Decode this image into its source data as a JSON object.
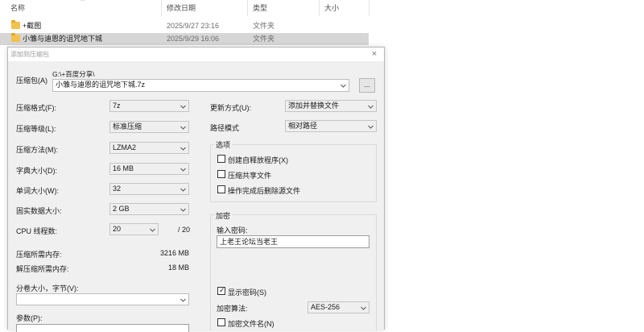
{
  "explorer": {
    "headers": {
      "name": "名称",
      "date": "修改日期",
      "type": "类型",
      "size": "大小"
    },
    "rows": [
      {
        "name": "+截图",
        "date": "2025/9/27 23:16",
        "type": "文件夹",
        "selected": false
      },
      {
        "name": "小雏与迪恩的诅咒地下城",
        "date": "2025/9/29 16:06",
        "type": "文件夹",
        "selected": true
      }
    ]
  },
  "dialog": {
    "title": "添加到压缩包",
    "archive": {
      "label": "压缩包(A)",
      "path": "G:\\+百度分享\\",
      "value": "小雏与迪恩的诅咒地下城.7z",
      "browse_label": "..."
    },
    "format": {
      "label": "压缩格式(F):",
      "value": "7z"
    },
    "level": {
      "label": "压缩等级(L):",
      "value": "标准压缩"
    },
    "method": {
      "label": "压缩方法(M):",
      "value": "LZMA2"
    },
    "dict": {
      "label": "字典大小(D):",
      "value": "16 MB"
    },
    "word": {
      "label": "单词大小(W):",
      "value": "32"
    },
    "solid": {
      "label": "固实数据大小:",
      "value": "2 GB"
    },
    "threads": {
      "label": "CPU 线程数:",
      "value": "20",
      "total": "/ 20"
    },
    "mem_compress": {
      "label": "压缩所需内存:",
      "value": "3216 MB"
    },
    "mem_decompress": {
      "label": "解压缩所需内存:",
      "value": "18 MB"
    },
    "split": {
      "label": "分卷大小，字节(V):",
      "value": ""
    },
    "params": {
      "label": "参数(P):",
      "value": ""
    },
    "update": {
      "label": "更新方式(U):",
      "value": "添加并替换文件"
    },
    "pathmode": {
      "label": "路径模式",
      "value": "相对路径"
    },
    "options": {
      "title": "选项",
      "items": [
        {
          "label": "创建自释放程序(X)",
          "checked": false
        },
        {
          "label": "压缩共享文件",
          "checked": false
        },
        {
          "label": "操作完成后删除源文件",
          "checked": false
        }
      ]
    },
    "encryption": {
      "title": "加密",
      "password_label": "输入密码:",
      "password_value": "上老王论坛当老王",
      "show_password": {
        "label": "显示密码(S)",
        "checked": true
      },
      "method_label": "加密算法:",
      "method_value": "AES-256",
      "encrypt_names": {
        "label": "加密文件名(N)",
        "checked": false
      }
    },
    "close_label": "×"
  }
}
